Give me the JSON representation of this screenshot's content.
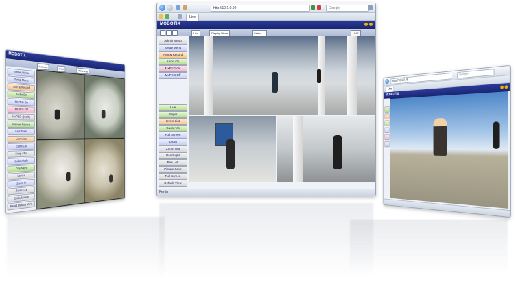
{
  "center_window": {
    "url": "http://10.1.0.99",
    "search_placeholder": "Google",
    "tab_label": "Live",
    "brand": "MOBOTIX",
    "toolbar": {
      "view_select": "Live",
      "mode_select": "Display Mode",
      "camera_select": "Select ...",
      "right_button": "LIVE"
    },
    "sidebar_top": [
      "Admin Menu",
      "Setup Menu",
      "Arm & Record",
      "Audio On",
      "MxPEG On",
      "MxPEG Off"
    ],
    "sidebar_mid": [
      "Live",
      "Player",
      "Event List",
      "Guest Vis",
      "Full Screen",
      "Zoom",
      "Zoom Out",
      "Pan Right",
      "Pan Left",
      "Picture Save",
      "Full Screen",
      "Default View"
    ],
    "status": "Fertig"
  },
  "left_window": {
    "brand": "MOBOTIX",
    "toolbar": {
      "view_select": "Multiview",
      "mode_select": "Quad",
      "camera_select": "All Cameras"
    },
    "sidebar": [
      "Admin Menu",
      "Setup Menu",
      "Arm & Record",
      "Audio On",
      "MxPEG On",
      "MxPEG Off",
      "MxPEG Quality",
      "Manual Record",
      "Last Event",
      "Live View",
      "Event List",
      "Snap Shot",
      "Color Mode",
      "Day/Night",
      "Layout",
      "Zoom In",
      "Zoom Out",
      "Default View",
      "Reset Default View"
    ]
  },
  "right_window": {
    "url": "http://10.1.0.99",
    "search_placeholder": "Google",
    "brand": "MOBOTIX",
    "tab_label": "Live",
    "status": ""
  }
}
